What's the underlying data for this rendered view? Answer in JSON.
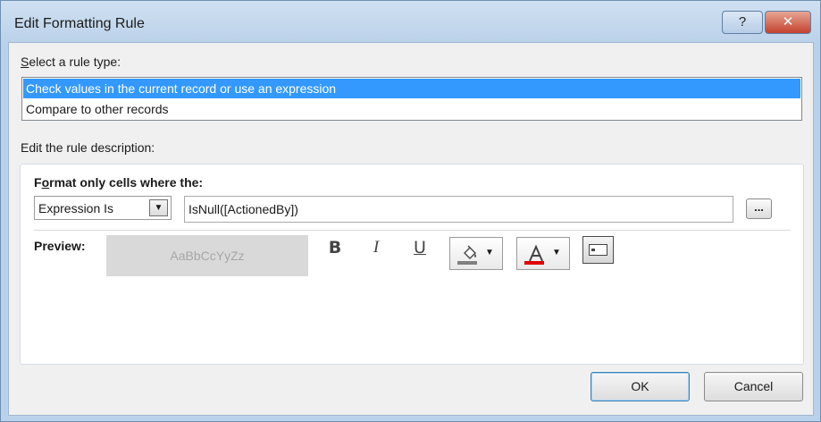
{
  "window": {
    "title": "Edit Formatting Rule",
    "help_label": "?",
    "close_label": "✕"
  },
  "rule_type": {
    "label_first": "S",
    "label_rest": "elect a rule type:",
    "items": [
      {
        "label": "Check values in the current record or use an expression",
        "selected": true
      },
      {
        "label": "Compare to other records",
        "selected": false
      }
    ]
  },
  "description": {
    "label": "Edit the rule description:",
    "format_label_a": "F",
    "format_label_b": "o",
    "format_label_c": "rmat only cells where the:",
    "condition_type": "Expression Is",
    "expression": "IsNull([ActionedBy])",
    "ellipsis_label": "...",
    "preview_label": "Preview:",
    "preview_sample": "AaBbCcYyZz",
    "bold_label": "B",
    "italic_label": "I",
    "underline_label": "U",
    "fill_color": "#808080",
    "font_color": "#e00000"
  },
  "buttons": {
    "ok": "OK",
    "cancel": "Cancel"
  },
  "icons": {
    "dropdown": "chevron-down-icon",
    "fill": "paint-bucket-icon",
    "font_color": "font-color-icon",
    "toggle": "enable-toggle-icon"
  }
}
